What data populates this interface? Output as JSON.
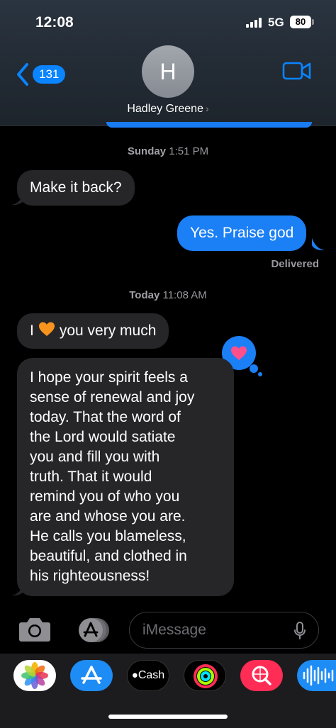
{
  "status_bar": {
    "time": "12:08",
    "network": "5G",
    "battery": "80"
  },
  "header": {
    "back_count": "131",
    "avatar_initial": "H",
    "contact_name": "Hadley Greene",
    "chevron": "›"
  },
  "messages": {
    "timestamp1_day": "Sunday",
    "timestamp1_time": "1:51 PM",
    "msg1": "Make it back?",
    "msg2": "Yes. Praise god",
    "delivered": "Delivered",
    "timestamp2_day": "Today",
    "timestamp2_time": "11:08 AM",
    "msg3_prefix": "I",
    "msg3_suffix": "you very much",
    "msg4_lines": [
      "I hope your spirit feels a",
      "sense of renewal and joy",
      "today. That the word of",
      "the Lord would satiate",
      "you and fill you with",
      "truth. That it would",
      "remind you of who you",
      "are and whose you are.",
      "He calls you blameless,",
      "beautiful, and clothed in",
      "his righteousness!"
    ],
    "tapback_icon": "heart-icon"
  },
  "input": {
    "placeholder": "iMessage"
  },
  "app_drawer": {
    "apps": [
      "photos-icon",
      "app-store-icon",
      "apple-cash-icon",
      "activity-icon",
      "search-images-icon",
      "audio-message-icon"
    ],
    "cash_label": "Cash"
  },
  "colors": {
    "accent": "#0a84ff",
    "outgoing": "#1b7ff5",
    "incoming": "#262629",
    "heart_orange": "#f7941d",
    "heart_pink": "#ff4f8b"
  }
}
